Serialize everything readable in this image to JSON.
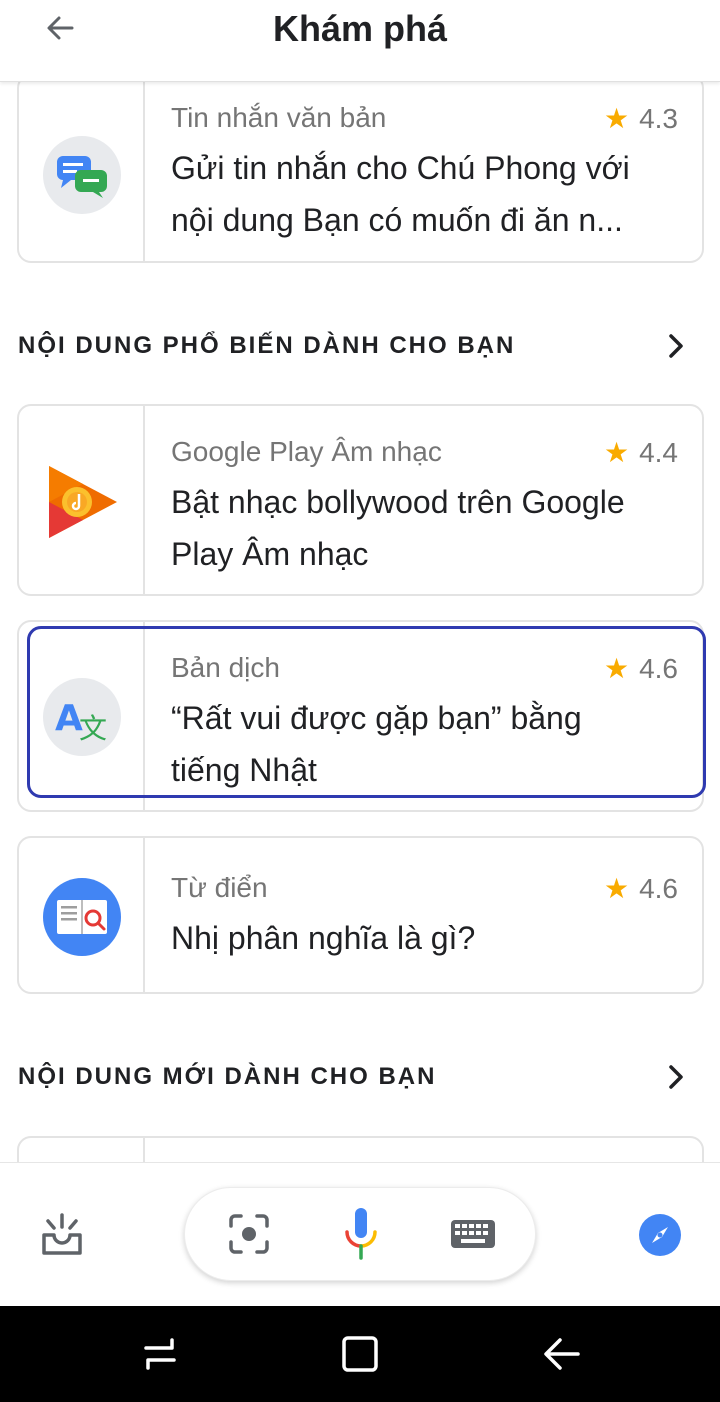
{
  "header": {
    "title": "Khám phá"
  },
  "cards_top": [
    {
      "category": "Tin nhắn văn bản",
      "rating": "4.3",
      "text_line1": "Gửi tin nhắn cho Chú Phong với",
      "text_line2": "nội dung Bạn có muốn đi ăn n..."
    }
  ],
  "section_popular": {
    "title": "NỘI DUNG PHỔ BIẾN DÀNH CHO BẠN"
  },
  "cards_popular": [
    {
      "category": "Google Play Âm nhạc",
      "rating": "4.4",
      "text_line1": "Bật nhạc bollywood trên Google",
      "text_line2": "Play Âm nhạc"
    },
    {
      "category": "Bản dịch",
      "rating": "4.6",
      "text_line1": "“Rất vui được gặp bạn” bằng",
      "text_line2": "tiếng Nhật"
    },
    {
      "category": "Từ điển",
      "rating": "4.6",
      "text_line1": "Nhị phân nghĩa là gì?"
    }
  ],
  "section_new": {
    "title": "NỘI DUNG MỚI DÀNH CHO BẠN"
  },
  "colors": {
    "accent_blue": "#4285f4",
    "highlight": "#2f3ab0",
    "star": "#f9ab00"
  }
}
